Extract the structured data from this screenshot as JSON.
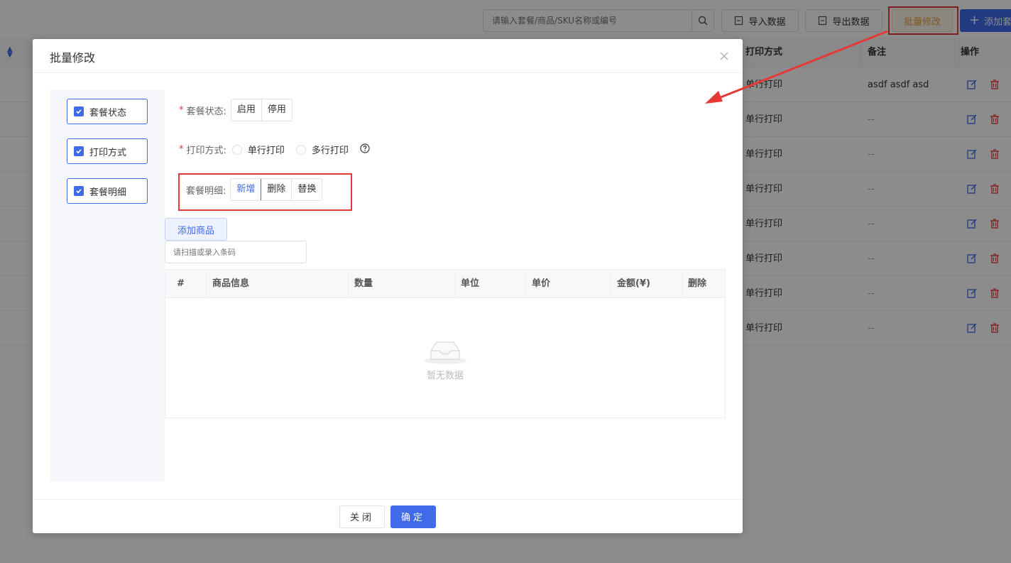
{
  "toolbar": {
    "search_placeholder": "请输入套餐/商品/SKU名称或编号",
    "import_label": "导入数据",
    "export_label": "导出数据",
    "batch_label": "批量修改",
    "add_label": "添加套"
  },
  "table": {
    "headers": {
      "print_mode": "打印方式",
      "remark": "备注",
      "actions": "操作"
    },
    "rows": [
      {
        "print_mode": "单行打印",
        "remark": "asdf asdf asd"
      },
      {
        "print_mode": "单行打印",
        "remark": "--"
      },
      {
        "print_mode": "单行打印",
        "remark": "--"
      },
      {
        "print_mode": "单行打印",
        "remark": "--"
      },
      {
        "print_mode": "单行打印",
        "remark": "--"
      },
      {
        "print_mode": "单行打印",
        "remark": "--"
      },
      {
        "print_mode": "单行打印",
        "remark": "--"
      },
      {
        "print_mode": "单行打印",
        "remark": "--"
      }
    ]
  },
  "dialog": {
    "title": "批量修改",
    "checkboxes": [
      "套餐状态",
      "打印方式",
      "套餐明细"
    ],
    "status": {
      "label": "套餐状态:",
      "options": [
        "启用",
        "停用"
      ]
    },
    "print": {
      "label": "打印方式:",
      "options": [
        "单行打印",
        "多行打印"
      ]
    },
    "detail": {
      "label": "套餐明细:",
      "options": [
        "新增",
        "删除",
        "替换"
      ]
    },
    "add_goods": "添加商品",
    "scan_placeholder": "请扫描或录入条码",
    "goods_headers": [
      "#",
      "商品信息",
      "数量",
      "单位",
      "单价",
      "金额(¥)",
      "删除"
    ],
    "empty_text": "暂无数据",
    "close_label": "关闭",
    "confirm_label": "确定"
  },
  "colors": {
    "primary": "#3f6ae8",
    "warning": "#e6a23c",
    "annotation": "#e53935"
  }
}
